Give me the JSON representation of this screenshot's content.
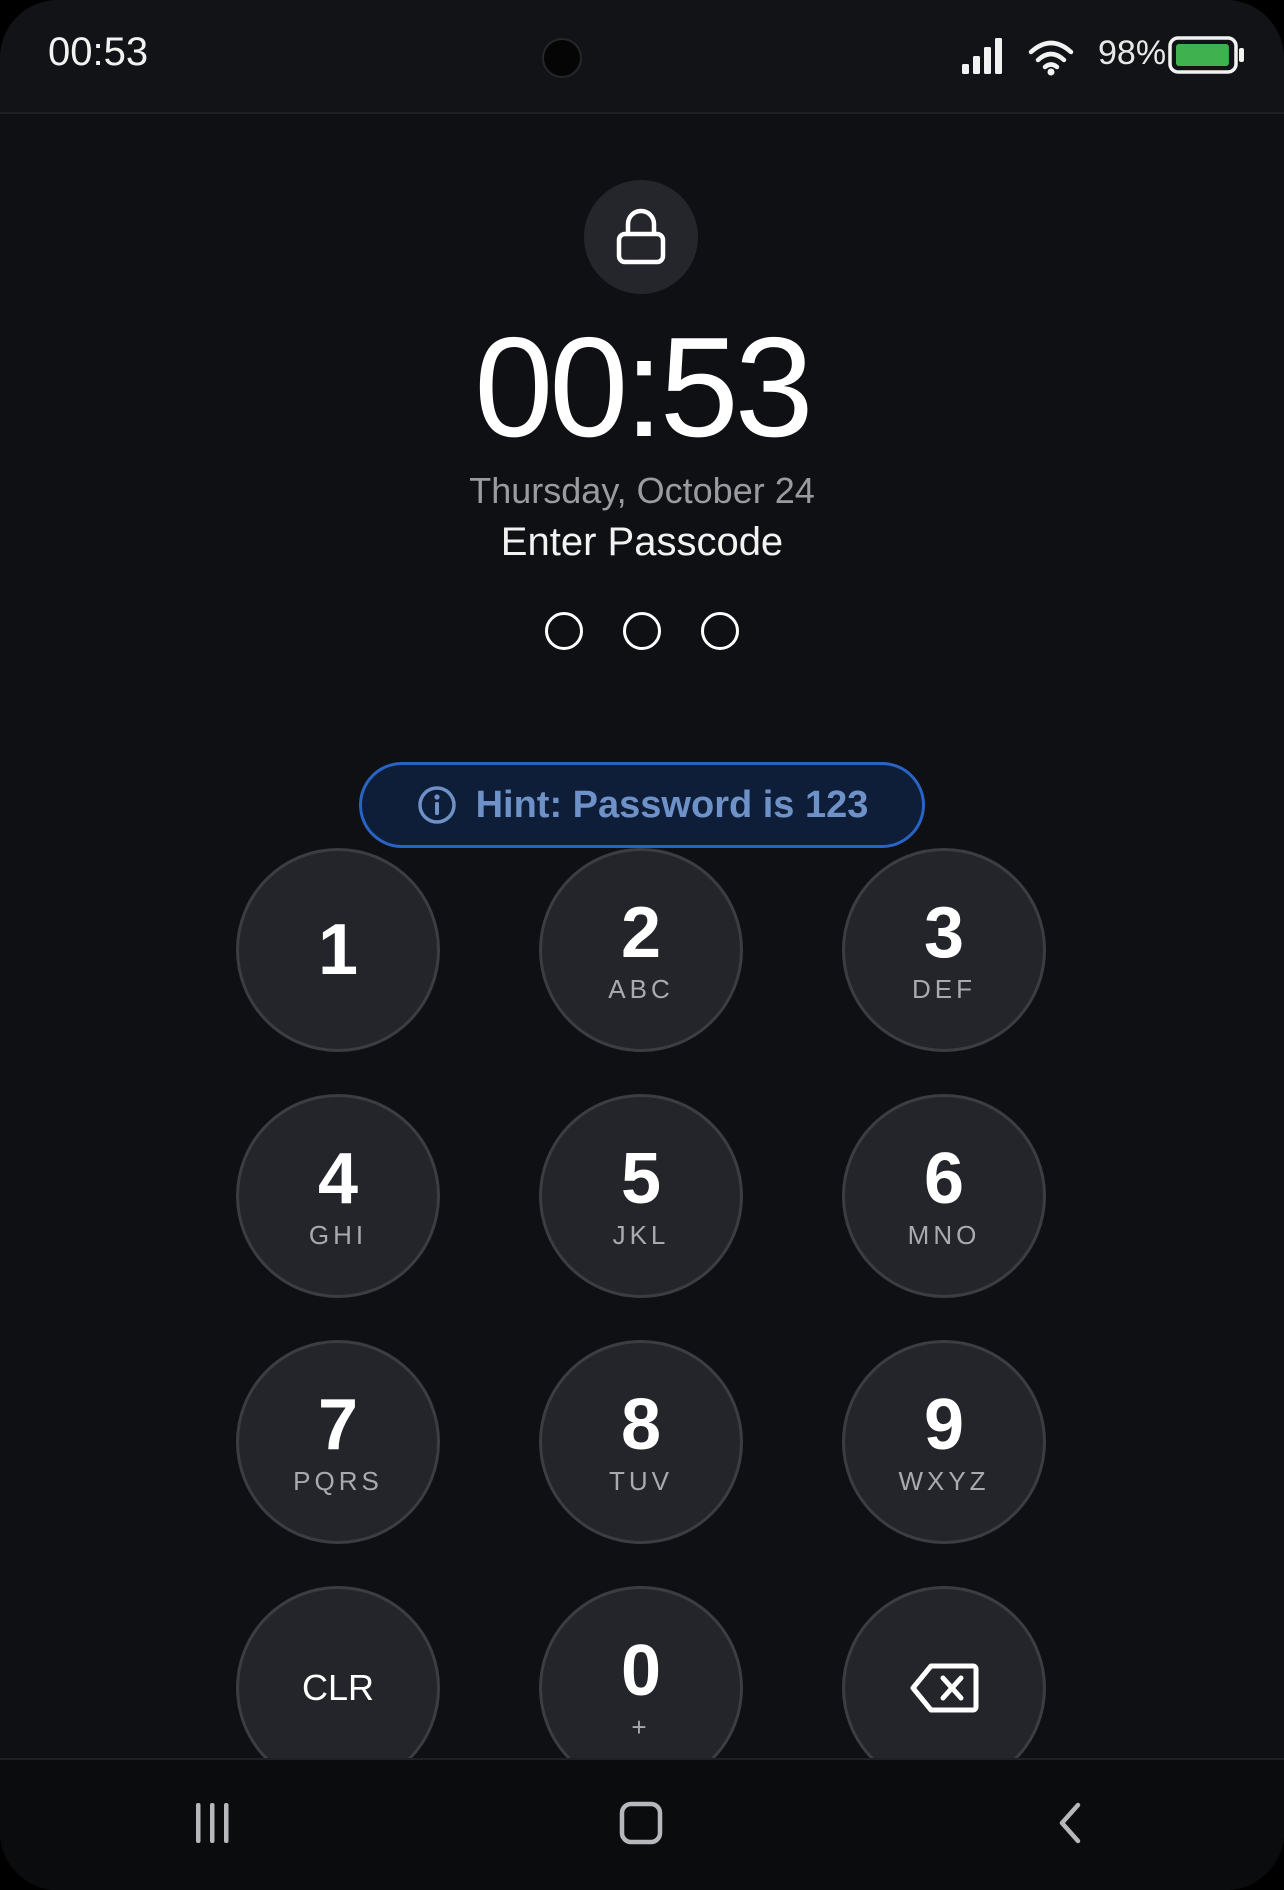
{
  "status_bar": {
    "time": "00:53",
    "battery_percent": "98%",
    "battery_level": 0.98,
    "icons": [
      "signal-icon",
      "wifi-icon",
      "battery-icon"
    ]
  },
  "lock_screen": {
    "lock_icon": "lock-icon",
    "clock": "00:53",
    "date": "Thursday, October 24",
    "prompt": "Enter Passcode",
    "passcode_length": 3,
    "passcode_entered": 0
  },
  "hint": {
    "icon": "info-icon",
    "text": "Hint: Password is 123"
  },
  "keypad": {
    "keys": [
      {
        "digit": "1",
        "letters": ""
      },
      {
        "digit": "2",
        "letters": "ABC"
      },
      {
        "digit": "3",
        "letters": "DEF"
      },
      {
        "digit": "4",
        "letters": "GHI"
      },
      {
        "digit": "5",
        "letters": "JKL"
      },
      {
        "digit": "6",
        "letters": "MNO"
      },
      {
        "digit": "7",
        "letters": "PQRS"
      },
      {
        "digit": "8",
        "letters": "TUV"
      },
      {
        "digit": "9",
        "letters": "WXYZ"
      },
      {
        "label": "CLR"
      },
      {
        "digit": "0",
        "letters": "+"
      },
      {
        "icon": "backspace-icon"
      }
    ]
  },
  "nav_bar": {
    "icons": [
      "recent-apps-icon",
      "home-icon",
      "back-icon"
    ]
  },
  "colors": {
    "background": "#0f1013",
    "key_fill": "#24252a",
    "hint_border": "#2a63c4",
    "hint_text": "#6e91c7",
    "battery_fill": "#3fb24f"
  }
}
